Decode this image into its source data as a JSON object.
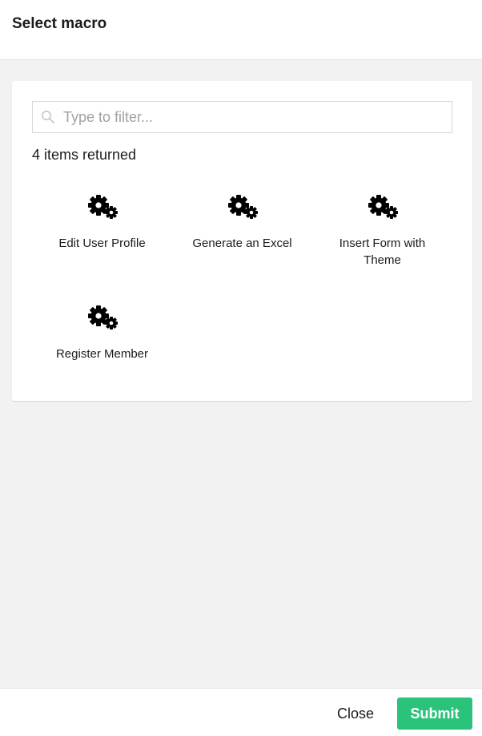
{
  "dialog": {
    "title": "Select macro"
  },
  "search": {
    "placeholder": "Type to filter...",
    "value": ""
  },
  "results": {
    "count_text": "4 items returned"
  },
  "macros": [
    {
      "label": "Edit User Profile",
      "icon": "gears-icon"
    },
    {
      "label": "Generate an Excel",
      "icon": "gears-icon"
    },
    {
      "label": "Insert Form with Theme",
      "icon": "gears-icon"
    },
    {
      "label": "Register Member",
      "icon": "gears-icon"
    }
  ],
  "footer": {
    "close_label": "Close",
    "submit_label": "Submit"
  },
  "colors": {
    "submit_bg": "#2bc37c",
    "page_bg": "#f3f2f3",
    "panel_bg": "#ffffff"
  }
}
